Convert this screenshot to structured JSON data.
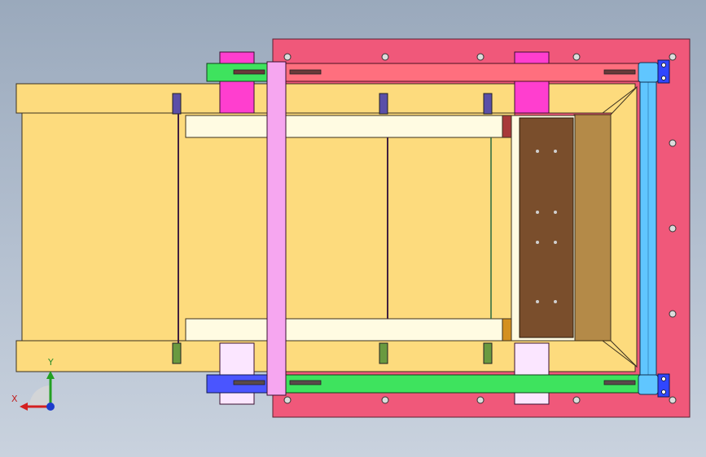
{
  "viewport": {
    "background_top": "#9aa9bc",
    "background_bottom": "#c9d2de"
  },
  "triad": {
    "x_label": "X",
    "y_label": "Y",
    "x_color": "#d42020",
    "y_color": "#22a022",
    "z_color": "#1c3ccc"
  },
  "model": {
    "colors": {
      "base_plate": "#f0587a",
      "chute_body": "#fddb7d",
      "upper_rail": "#ff6f7e",
      "lower_rail": "#3ee35e",
      "left_bracket_top": "#3ee35e",
      "left_bracket_bottom": "#4a55ff",
      "bearing_top": "#ff3ecf",
      "bearing_bottom": "#fbe6ff",
      "crossbar": "#f6a6f0",
      "end_roller": "#60c6ff",
      "gate_plate": "#7a4e2c",
      "hopper_back": "#b48a48",
      "inner_bar": "#fffbe2",
      "post": "#3b6fbf"
    }
  }
}
